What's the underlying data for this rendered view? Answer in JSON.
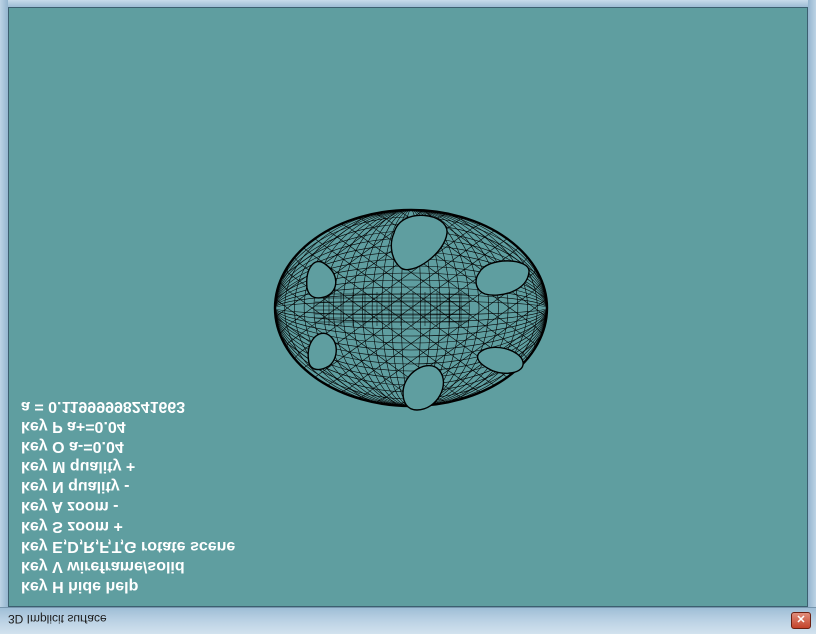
{
  "window": {
    "title": "3D Implicit surface",
    "close_symbol": "✕"
  },
  "scene": {
    "background": "#5f9ea0",
    "wire_color": "#000000"
  },
  "help": {
    "lines": [
      "key H  hide help",
      "key V  wireframe/solid",
      "key E,D,R,F,T,G  rotate scene",
      "key S  zoom +",
      "key A  zoom -",
      "key N  quality -",
      "key M  quality +",
      "key O  a-=0.04",
      "key P  a+=0.04",
      "a = 0.11999998241663"
    ]
  }
}
